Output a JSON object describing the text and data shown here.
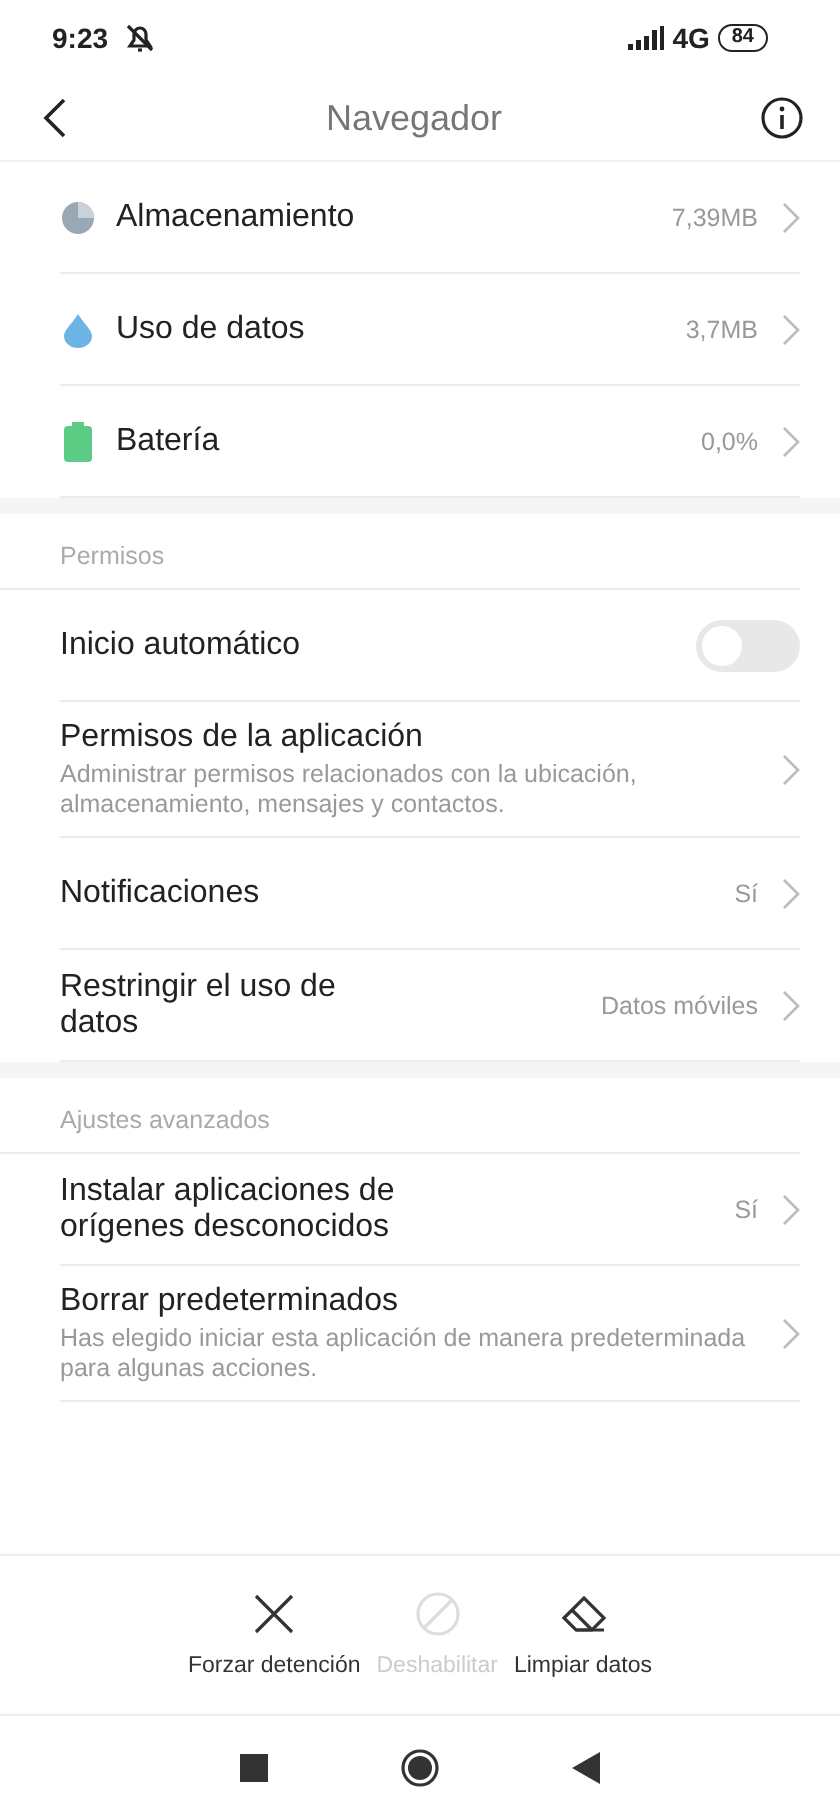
{
  "status_bar": {
    "time": "9:23",
    "network": "4G",
    "battery": "84"
  },
  "header": {
    "title": "Navegador"
  },
  "sections": [
    {
      "items": [
        {
          "kind": "value",
          "title": "Almacenamiento",
          "value": "7,39MB"
        },
        {
          "kind": "value",
          "title": "Uso de datos",
          "value": "3,7MB"
        },
        {
          "kind": "value",
          "title": "Batería",
          "value": "0,0%"
        }
      ]
    },
    {
      "heading": "Permisos",
      "items": [
        {
          "kind": "toggle",
          "title": "Inicio automático",
          "on": false
        },
        {
          "kind": "value",
          "title": "Permisos de la aplicación",
          "subtitle": "Administrar permisos relacionados con la ubicación, almacenamiento, mensajes y contactos."
        },
        {
          "kind": "value",
          "title": "Notificaciones",
          "value": "Sí"
        },
        {
          "kind": "value",
          "title": "Restringir el uso de datos",
          "value": "Datos móviles"
        }
      ]
    },
    {
      "heading": "Ajustes avanzados",
      "items": [
        {
          "kind": "value",
          "title": "Instalar aplicaciones de orígenes desconocidos",
          "value": "Sí"
        },
        {
          "kind": "value",
          "title": "Borrar predeterminados",
          "subtitle": "Has elegido iniciar esta aplicación de manera predeterminada para algunas acciones."
        }
      ]
    }
  ],
  "actions": [
    {
      "label": "Forzar detención",
      "disabled": false
    },
    {
      "label": "Deshabilitar",
      "disabled": true
    },
    {
      "label": "Limpiar datos",
      "disabled": false
    }
  ]
}
